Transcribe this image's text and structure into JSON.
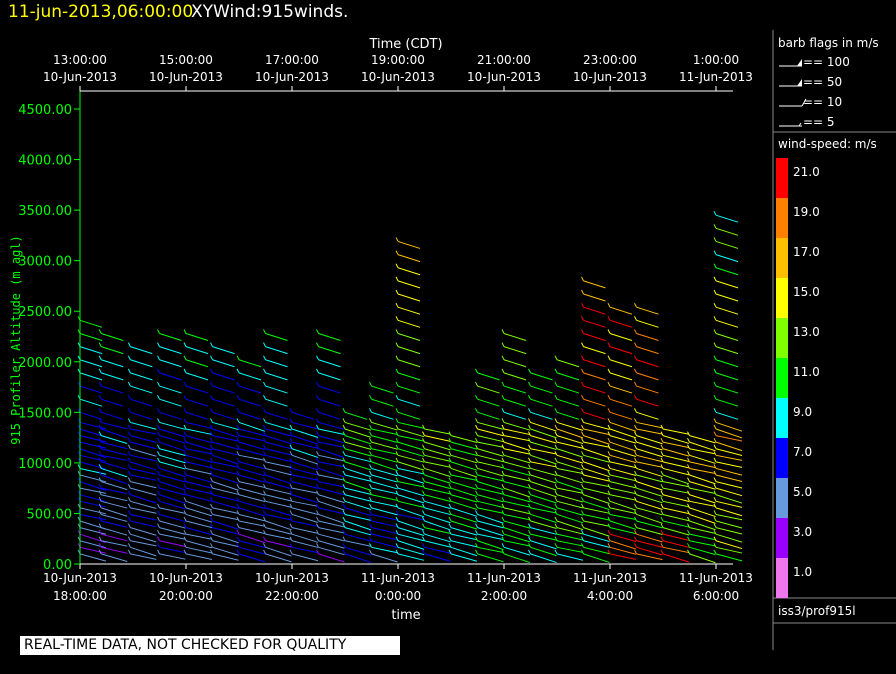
{
  "header": {
    "timestamp": "11-jun-2013,06:00:00",
    "plot_name": "XYWind:915winds."
  },
  "legend": {
    "barb_title": "barb flags in m/s",
    "barbs": [
      {
        "label": "== 100",
        "value": 100
      },
      {
        "label": "== 50",
        "value": 50
      },
      {
        "label": "== 10",
        "value": 10
      },
      {
        "label": "== 5",
        "value": 5
      }
    ],
    "speed_title": "wind-speed: m/s",
    "speed_scale": [
      {
        "label": "21.0",
        "color": "#ff0000"
      },
      {
        "label": "19.0",
        "color": "#ff8000"
      },
      {
        "label": "17.0",
        "color": "#ffbf00"
      },
      {
        "label": "15.0",
        "color": "#ffff00"
      },
      {
        "label": "13.0",
        "color": "#80ff00"
      },
      {
        "label": "11.0",
        "color": "#00ff00"
      },
      {
        "label": "9.0",
        "color": "#00ffff"
      },
      {
        "label": "7.0",
        "color": "#0000ff"
      },
      {
        "label": "5.0",
        "color": "#6699dd"
      },
      {
        "label": "3.0",
        "color": "#9900ff"
      },
      {
        "label": "1.0",
        "color": "#ee77ee"
      }
    ],
    "source": "iss3/prof915l"
  },
  "notice": "REAL-TIME DATA, NOT CHECKED FOR QUALITY",
  "chart_data": {
    "type": "scatter",
    "title": "",
    "xlabel": "time",
    "x2label": "Time (CDT)",
    "ylabel": "915 Profiler Altitude (m agl)",
    "ylim": [
      0,
      4500
    ],
    "xlim_hours": [
      18,
      30.8
    ],
    "yticks": [
      "0.00",
      "500.00",
      "1000.00",
      "1500.00",
      "2000.00",
      "2500.00",
      "3000.00",
      "3500.00",
      "4000.00",
      "4500.00"
    ],
    "ytick_values": [
      0,
      500,
      1000,
      1500,
      2000,
      2500,
      3000,
      3500,
      4000,
      4500
    ],
    "xticks_bottom": [
      {
        "h": 18,
        "date": "10-Jun-2013",
        "time": "18:00:00"
      },
      {
        "h": 20,
        "date": "10-Jun-2013",
        "time": "20:00:00"
      },
      {
        "h": 22,
        "date": "10-Jun-2013",
        "time": "22:00:00"
      },
      {
        "h": 24,
        "date": "11-Jun-2013",
        "time": "0:00:00"
      },
      {
        "h": 26,
        "date": "11-Jun-2013",
        "time": "2:00:00"
      },
      {
        "h": 28,
        "date": "11-Jun-2013",
        "time": "4:00:00"
      },
      {
        "h": 30,
        "date": "11-Jun-2013",
        "time": "6:00:00"
      }
    ],
    "xticks_top": [
      {
        "h": 18,
        "time": "13:00:00",
        "date": "10-Jun-2013"
      },
      {
        "h": 20,
        "time": "15:00:00",
        "date": "10-Jun-2013"
      },
      {
        "h": 22,
        "time": "17:00:00",
        "date": "10-Jun-2013"
      },
      {
        "h": 24,
        "time": "19:00:00",
        "date": "10-Jun-2013"
      },
      {
        "h": 26,
        "time": "21:00:00",
        "date": "10-Jun-2013"
      },
      {
        "h": 28,
        "time": "23:00:00",
        "date": "10-Jun-2013"
      },
      {
        "h": 30,
        "time": "1:00:00",
        "date": "11-Jun-2013"
      }
    ],
    "profiles": [
      {
        "t": 18.0,
        "top": 2450
      },
      {
        "t": 18.4,
        "top": 2280
      },
      {
        "t": 18.95,
        "top": 2250
      },
      {
        "t": 19.5,
        "top": 2300
      },
      {
        "t": 20.0,
        "top": 2300
      },
      {
        "t": 20.5,
        "top": 2150
      },
      {
        "t": 21.0,
        "top": 2050
      },
      {
        "t": 21.5,
        "top": 2350
      },
      {
        "t": 22.0,
        "top": 1550
      },
      {
        "t": 22.5,
        "top": 2280
      },
      {
        "t": 23.0,
        "top": 1550
      },
      {
        "t": 23.5,
        "top": 1850
      },
      {
        "t": 24.0,
        "top": 3250
      },
      {
        "t": 24.5,
        "top": 1350
      },
      {
        "t": 25.0,
        "top": 1300
      },
      {
        "t": 25.5,
        "top": 1950
      },
      {
        "t": 26.0,
        "top": 2350
      },
      {
        "t": 26.5,
        "top": 1900
      },
      {
        "t": 27.0,
        "top": 2050
      },
      {
        "t": 27.5,
        "top": 2800
      },
      {
        "t": 28.0,
        "top": 2650
      },
      {
        "t": 28.5,
        "top": 2650
      },
      {
        "t": 29.0,
        "top": 1350
      },
      {
        "t": 29.5,
        "top": 1300
      },
      {
        "t": 30.0,
        "top": 3450
      }
    ]
  }
}
